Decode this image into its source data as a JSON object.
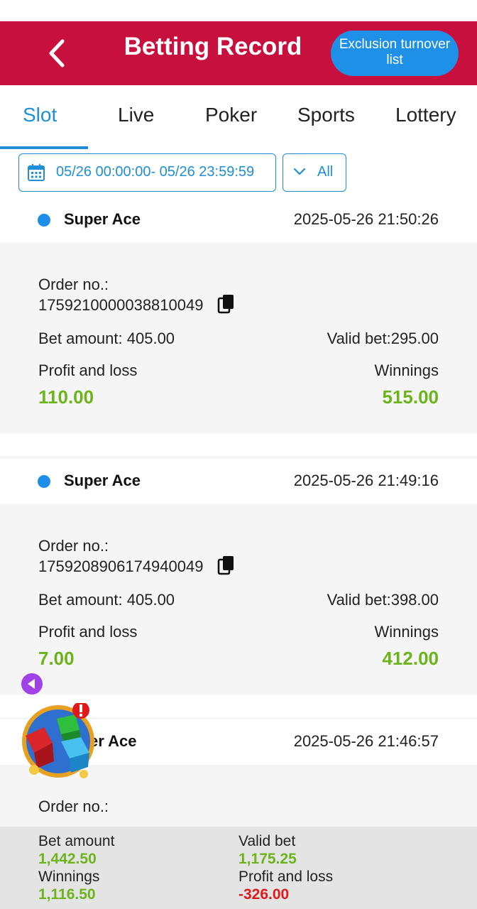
{
  "header": {
    "title": "Betting Record",
    "exclusion_button": "Exclusion turnover list"
  },
  "tabs": [
    "Slot",
    "Live",
    "Poker",
    "Sports",
    "Lottery"
  ],
  "filters": {
    "date_range": "05/26 00:00:00- 05/26 23:59:59",
    "type": "All"
  },
  "labels": {
    "order_no": "Order no.:",
    "bet_amount": "Bet amount: ",
    "valid_bet": "Valid bet:",
    "profit_and_loss": "Profit and loss",
    "winnings": "Winnings"
  },
  "records": [
    {
      "game": "Super Ace",
      "time": "2025-05-26 21:50:26",
      "order_no": "1759210000038810049",
      "bet_amount": "405.00",
      "valid_bet": "295.00",
      "profit_and_loss": "110.00",
      "winnings": "515.00"
    },
    {
      "game": "Super Ace",
      "time": "2025-05-26 21:49:16",
      "order_no": "1759208906174940049",
      "bet_amount": "405.00",
      "valid_bet": "398.00",
      "profit_and_loss": "7.00",
      "winnings": "412.00"
    },
    {
      "game": "er Ace",
      "time": "2025-05-26 21:46:57",
      "order_no": ""
    }
  ],
  "summary": {
    "bet_amount_label": "Bet amount",
    "bet_amount": "1,442.50",
    "valid_bet_label": "Valid bet",
    "valid_bet": "1,175.25",
    "winnings_label": "Winnings",
    "winnings": "1,116.50",
    "profit_and_loss_label": "Profit and loss",
    "profit_and_loss": "-326.00"
  },
  "colors": {
    "header_bg": "#c8103e",
    "accent_blue": "#1e8fd6",
    "positive_green": "#6cb31c",
    "negative_red": "#e01a1a"
  }
}
